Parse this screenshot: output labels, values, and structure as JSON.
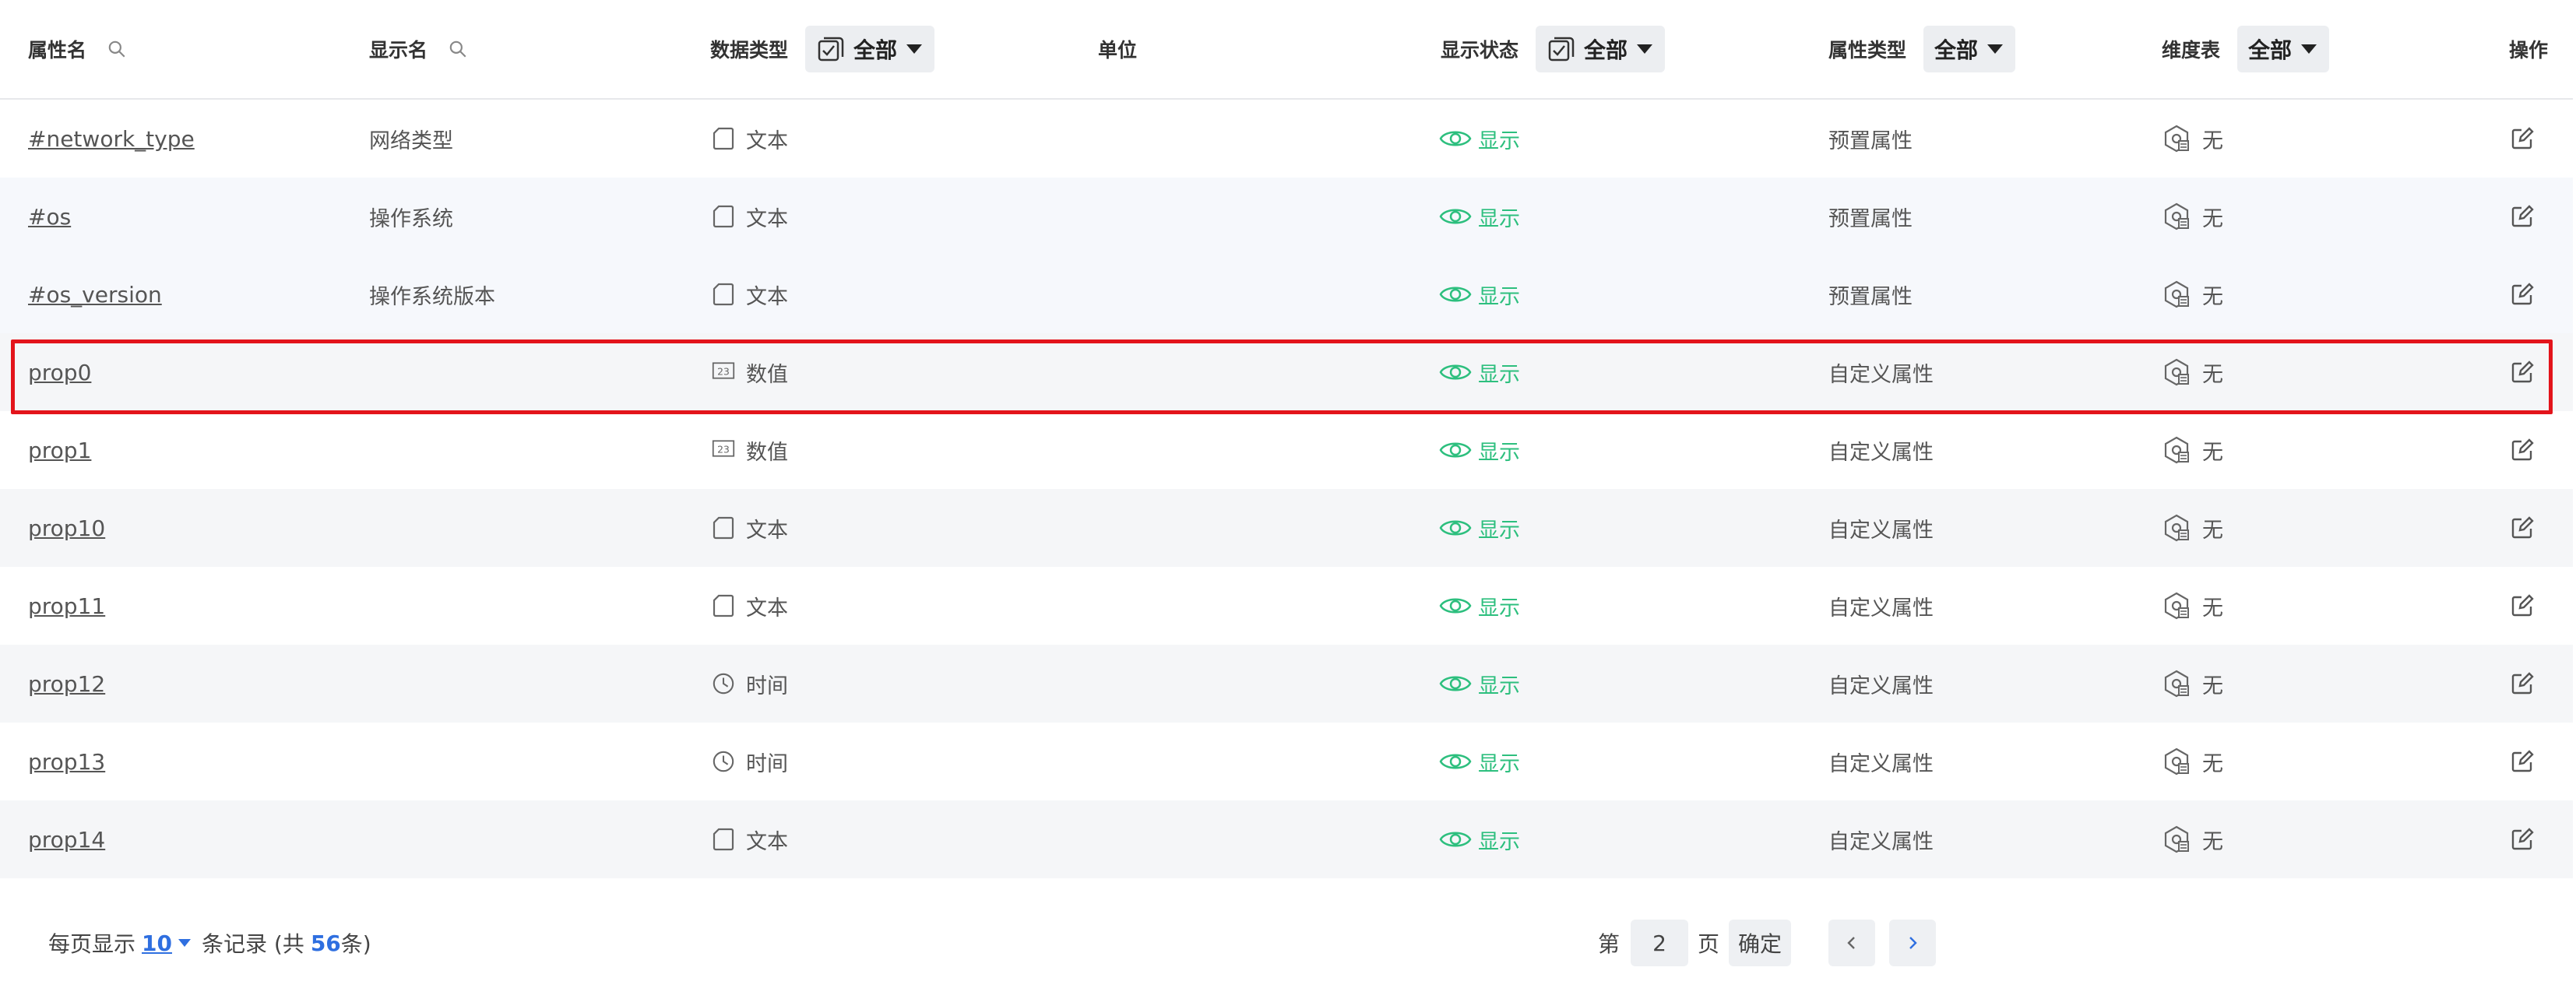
{
  "header": {
    "col_name": "属性名",
    "col_display": "显示名",
    "col_type": "数据类型",
    "col_type_filter": "全部",
    "col_unit": "单位",
    "col_status": "显示状态",
    "col_status_filter": "全部",
    "col_attr_type": "属性类型",
    "col_attr_type_filter": "全部",
    "col_dim": "维度表",
    "col_dim_filter": "全部",
    "col_action": "操作"
  },
  "rows": [
    {
      "name": "#network_type",
      "display": "网络类型",
      "type": "文本",
      "type_icon": "text-icon",
      "unit": "",
      "status": "显示",
      "attr_type": "预置属性",
      "dim": "无"
    },
    {
      "name": "#os",
      "display": "操作系统",
      "type": "文本",
      "type_icon": "text-icon",
      "unit": "",
      "status": "显示",
      "attr_type": "预置属性",
      "dim": "无"
    },
    {
      "name": "#os_version",
      "display": "操作系统版本",
      "type": "文本",
      "type_icon": "text-icon",
      "unit": "",
      "status": "显示",
      "attr_type": "预置属性",
      "dim": "无"
    },
    {
      "name": "prop0",
      "display": "",
      "type": "数值",
      "type_icon": "number-icon",
      "unit": "",
      "status": "显示",
      "attr_type": "自定义属性",
      "dim": "无"
    },
    {
      "name": "prop1",
      "display": "",
      "type": "数值",
      "type_icon": "number-icon",
      "unit": "",
      "status": "显示",
      "attr_type": "自定义属性",
      "dim": "无"
    },
    {
      "name": "prop10",
      "display": "",
      "type": "文本",
      "type_icon": "text-icon",
      "unit": "",
      "status": "显示",
      "attr_type": "自定义属性",
      "dim": "无"
    },
    {
      "name": "prop11",
      "display": "",
      "type": "文本",
      "type_icon": "text-icon",
      "unit": "",
      "status": "显示",
      "attr_type": "自定义属性",
      "dim": "无"
    },
    {
      "name": "prop12",
      "display": "",
      "type": "时间",
      "type_icon": "clock-icon",
      "unit": "",
      "status": "显示",
      "attr_type": "自定义属性",
      "dim": "无"
    },
    {
      "name": "prop13",
      "display": "",
      "type": "时间",
      "type_icon": "clock-icon",
      "unit": "",
      "status": "显示",
      "attr_type": "自定义属性",
      "dim": "无"
    },
    {
      "name": "prop14",
      "display": "",
      "type": "文本",
      "type_icon": "text-icon",
      "unit": "",
      "status": "显示",
      "attr_type": "自定义属性",
      "dim": "无"
    }
  ],
  "pagination": {
    "per_page_label": "每页显示",
    "per_page_value": "10",
    "records_label": "条记录 (共",
    "total": "56",
    "total_suffix": "条)",
    "page_prefix": "第",
    "page_value": "2",
    "page_suffix": "页",
    "confirm": "确定"
  },
  "colors": {
    "accent_blue": "#2f6fe0",
    "status_green": "#2dbf7e",
    "highlight_red": "#e3141b"
  }
}
